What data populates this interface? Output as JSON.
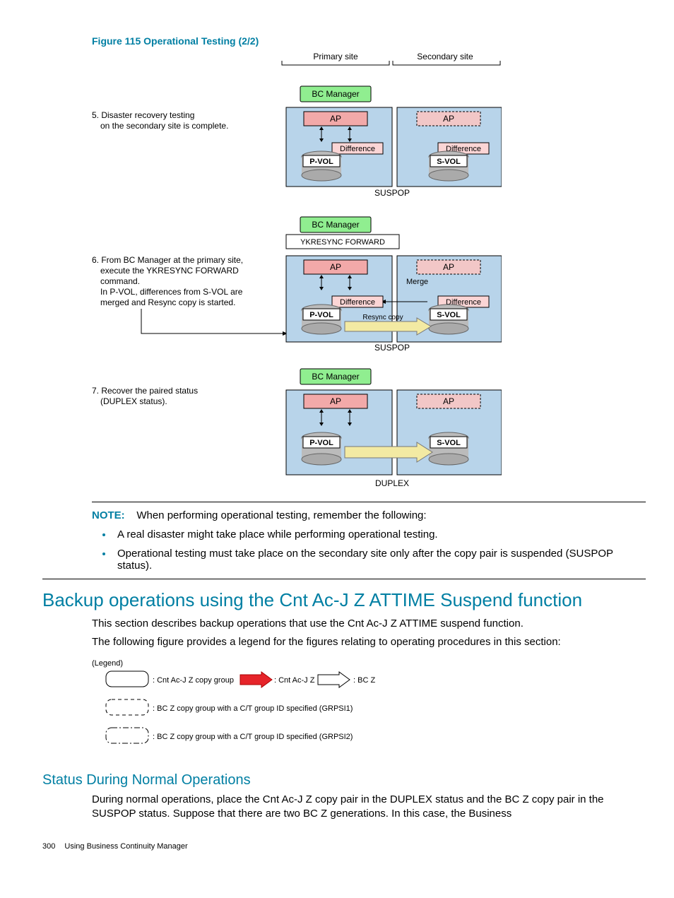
{
  "figure": {
    "caption": "Figure 115 Operational Testing (2/2)",
    "primary_site_label": "Primary site",
    "secondary_site_label": "Secondary site",
    "bc_manager": "BC Manager",
    "ap": "AP",
    "difference": "Difference",
    "pvol": "P-VOL",
    "svol": "S-VOL",
    "suspop": "SUSPOP",
    "duplex": "DUPLEX",
    "ykresync": "YKRESYNC FORWARD",
    "merge": "Merge",
    "resync_copy": "Resync copy",
    "step5_line1": "5. Disaster recovery testing",
    "step5_line2": "on the secondary site is complete.",
    "step6_line1": "6. From BC Manager at the primary site,",
    "step6_line2": "execute the YKRESYNC FORWARD",
    "step6_line3": "command.",
    "step6_line4": "In P-VOL, differences from S-VOL are",
    "step6_line5": "merged and Resync copy is started.",
    "step7_line1": "7. Recover the paired status",
    "step7_line2": "(DUPLEX status)."
  },
  "note": {
    "label": "NOTE:",
    "intro": "When performing operational testing, remember the following:",
    "bullet1": "A real disaster might take place while performing operational testing.",
    "bullet2": "Operational testing must take place on the secondary site only after the copy pair is suspended (SUSPOP status)."
  },
  "section": {
    "heading": "Backup operations using the Cnt Ac-J Z ATTIME Suspend function",
    "p1": "This section describes backup operations that use the Cnt Ac-J Z ATTIME suspend function.",
    "p2": "The following figure provides a legend for the figures relating to operating procedures in this section:"
  },
  "legend": {
    "title": "(Legend)",
    "item1": ": Cnt Ac-J Z copy group",
    "item2": ": Cnt Ac-J Z",
    "item3": ": BC Z",
    "item4": ": BC Z copy group with a C/T group ID specified (GRPSI1)",
    "item5": ": BC Z  copy group with a C/T group ID specified (GRPSI2)"
  },
  "subsection": {
    "heading": "Status During Normal Operations",
    "p1": "During normal operations, place the Cnt Ac-J Z copy pair in the DUPLEX status and the BC Z copy pair in the SUSPOP status. Suppose that there are two BC Z generations. In this case, the Business"
  },
  "footer": {
    "page_number": "300",
    "title": "Using Business Continuity Manager"
  }
}
